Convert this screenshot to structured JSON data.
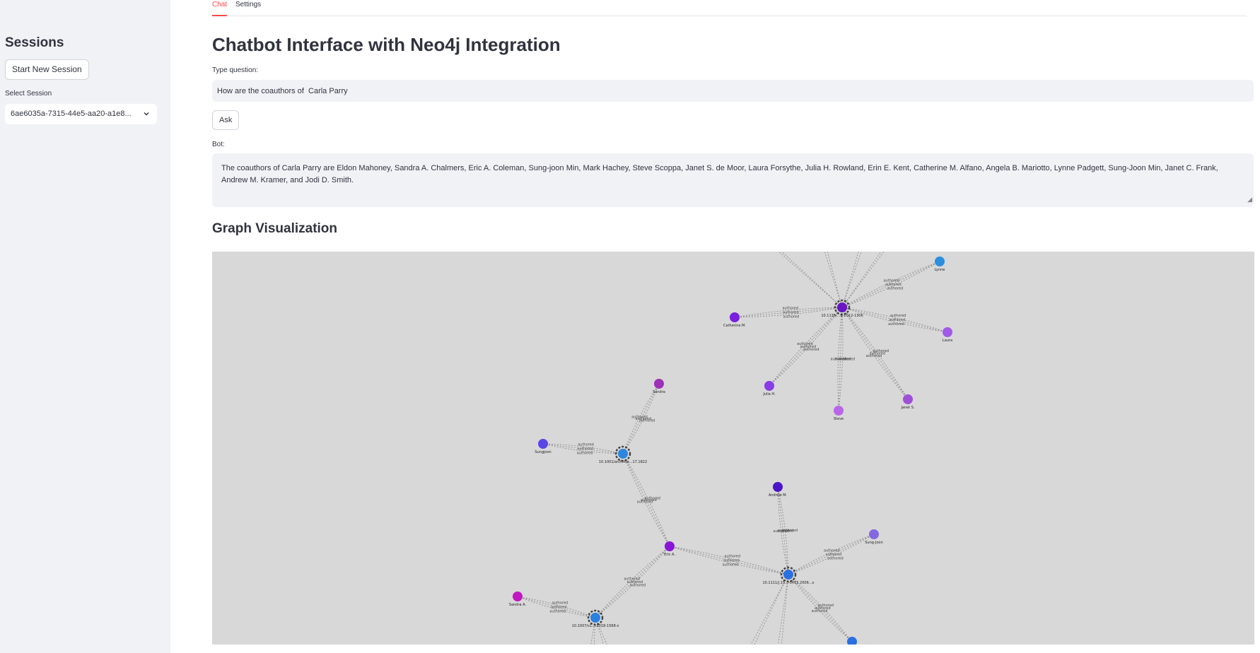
{
  "sidebar": {
    "title": "Sessions",
    "new_session_label": "Start New Session",
    "select_label": "Select Session",
    "selected_session": "6ae6035a-7315-44e5-aa20-a1e8..."
  },
  "tabs": [
    {
      "label": "Chat",
      "active": true
    },
    {
      "label": "Settings",
      "active": false
    }
  ],
  "main": {
    "title": "Chatbot Interface with Neo4j Integration",
    "question_label": "Type question:",
    "question_value": "How are the coauthors of  Carla Parry",
    "ask_label": "Ask",
    "bot_label": "Bot:",
    "bot_text": "The coauthors of Carla Parry are Eldon Mahoney, Sandra A. Chalmers, Eric A. Coleman, Sung-joon Min, Mark Hachey, Steve Scoppa, Janet S. de Moor, Laura Forsythe, Julia H. Rowland, Erin E. Kent, Catherine M. Alfano, Angela B. Mariotto, Lynne Padgett, Sung-Joon Min, Janet C. Frank, Andrew M. Kramer, and Jodi D. Smith.",
    "graph_title": "Graph Visualization"
  },
  "graph": {
    "edge_label": "authored",
    "nodes": [
      {
        "id": "p1",
        "label": "10.1136/...d-2012-1306",
        "color": "#6a14c8"
      },
      {
        "id": "catherine",
        "label": "Catherine M.",
        "color": "#7a1ee0"
      },
      {
        "id": "laura",
        "label": "Laura",
        "color": "#a05ae8"
      },
      {
        "id": "julia",
        "label": "Julia H.",
        "color": "#8a3ce6"
      },
      {
        "id": "steve",
        "label": "Steve",
        "color": "#b866e8"
      },
      {
        "id": "janets",
        "label": "Janet S.",
        "color": "#a050d8"
      },
      {
        "id": "lynne",
        "label": "Lynne",
        "color": "#2a8fe0"
      },
      {
        "id": "p2",
        "label": "10.1001/archinte...17.1822",
        "color": "#2f86de"
      },
      {
        "id": "sandra",
        "label": "Sandra",
        "color": "#9c30b8"
      },
      {
        "id": "sungjoon",
        "label": "Sungjoon",
        "color": "#5a46e8"
      },
      {
        "id": "eric",
        "label": "Eric A.",
        "color": "#8a14d8"
      },
      {
        "id": "p3",
        "label": "10.1111/j.15...-5415.2006...x",
        "color": "#2a70e0"
      },
      {
        "id": "andrewm",
        "label": "Andrew M.",
        "color": "#4a14c8"
      },
      {
        "id": "sungjoon2",
        "label": "Sung-Joon",
        "color": "#8468e0"
      },
      {
        "id": "p4",
        "label": "10.1007/s1...-2018-1568-z",
        "color": "#2a80e0"
      },
      {
        "id": "sandraa",
        "label": "Sandra A.",
        "color": "#c018c0"
      },
      {
        "id": "bottomright",
        "label": "",
        "color": "#2a70e0"
      }
    ]
  },
  "colors": {
    "accent": "#ff4b4b",
    "sidebar_bg": "#f0f2f6",
    "graph_bg": "#d8d8d8"
  }
}
